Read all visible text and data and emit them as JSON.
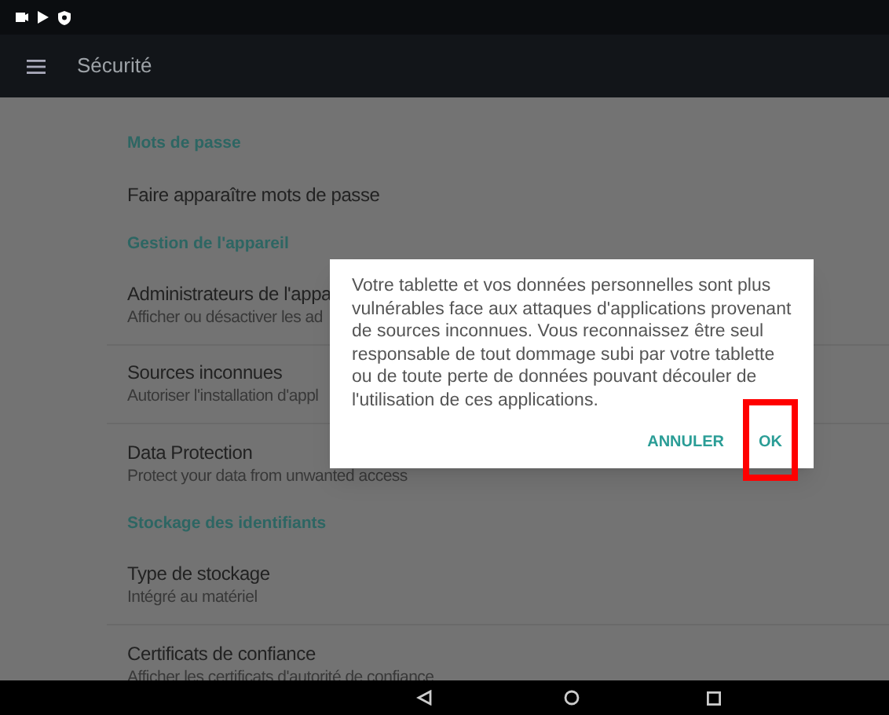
{
  "toolbar": {
    "title": "Sécurité"
  },
  "settings": [
    {
      "kind": "header",
      "title": "Mots de passe"
    },
    {
      "kind": "item",
      "title": "Faire apparaître mots de passe"
    },
    {
      "kind": "header",
      "title": "Gestion de l'appareil"
    },
    {
      "kind": "item",
      "title": "Administrateurs de l'appa",
      "subtitle": "Afficher ou désactiver les ad"
    },
    {
      "kind": "item",
      "title": "Sources inconnues",
      "subtitle": "Autoriser l'installation d'appl"
    },
    {
      "kind": "item",
      "title": "Data Protection",
      "subtitle": "Protect your data from unwanted access"
    },
    {
      "kind": "header",
      "title": "Stockage des identifiants"
    },
    {
      "kind": "item",
      "title": "Type de stockage",
      "subtitle": "Intégré au matériel"
    },
    {
      "kind": "item",
      "title": "Certificats de confiance",
      "subtitle": "Afficher les certificats d'autorité de confiance"
    }
  ],
  "dialog": {
    "message": "Votre tablette et vos données personnelles sont plus vulnérables face aux attaques d'applications provenant de sources inconnues. Vous reconnaissez être seul responsable de tout dommage subi par votre tablette ou de toute perte de données pouvant découler de l'utilisation de ces applications.",
    "buttons": [
      {
        "label": "ANNULER",
        "highlighted": false
      },
      {
        "label": "OK",
        "highlighted": true
      }
    ]
  }
}
